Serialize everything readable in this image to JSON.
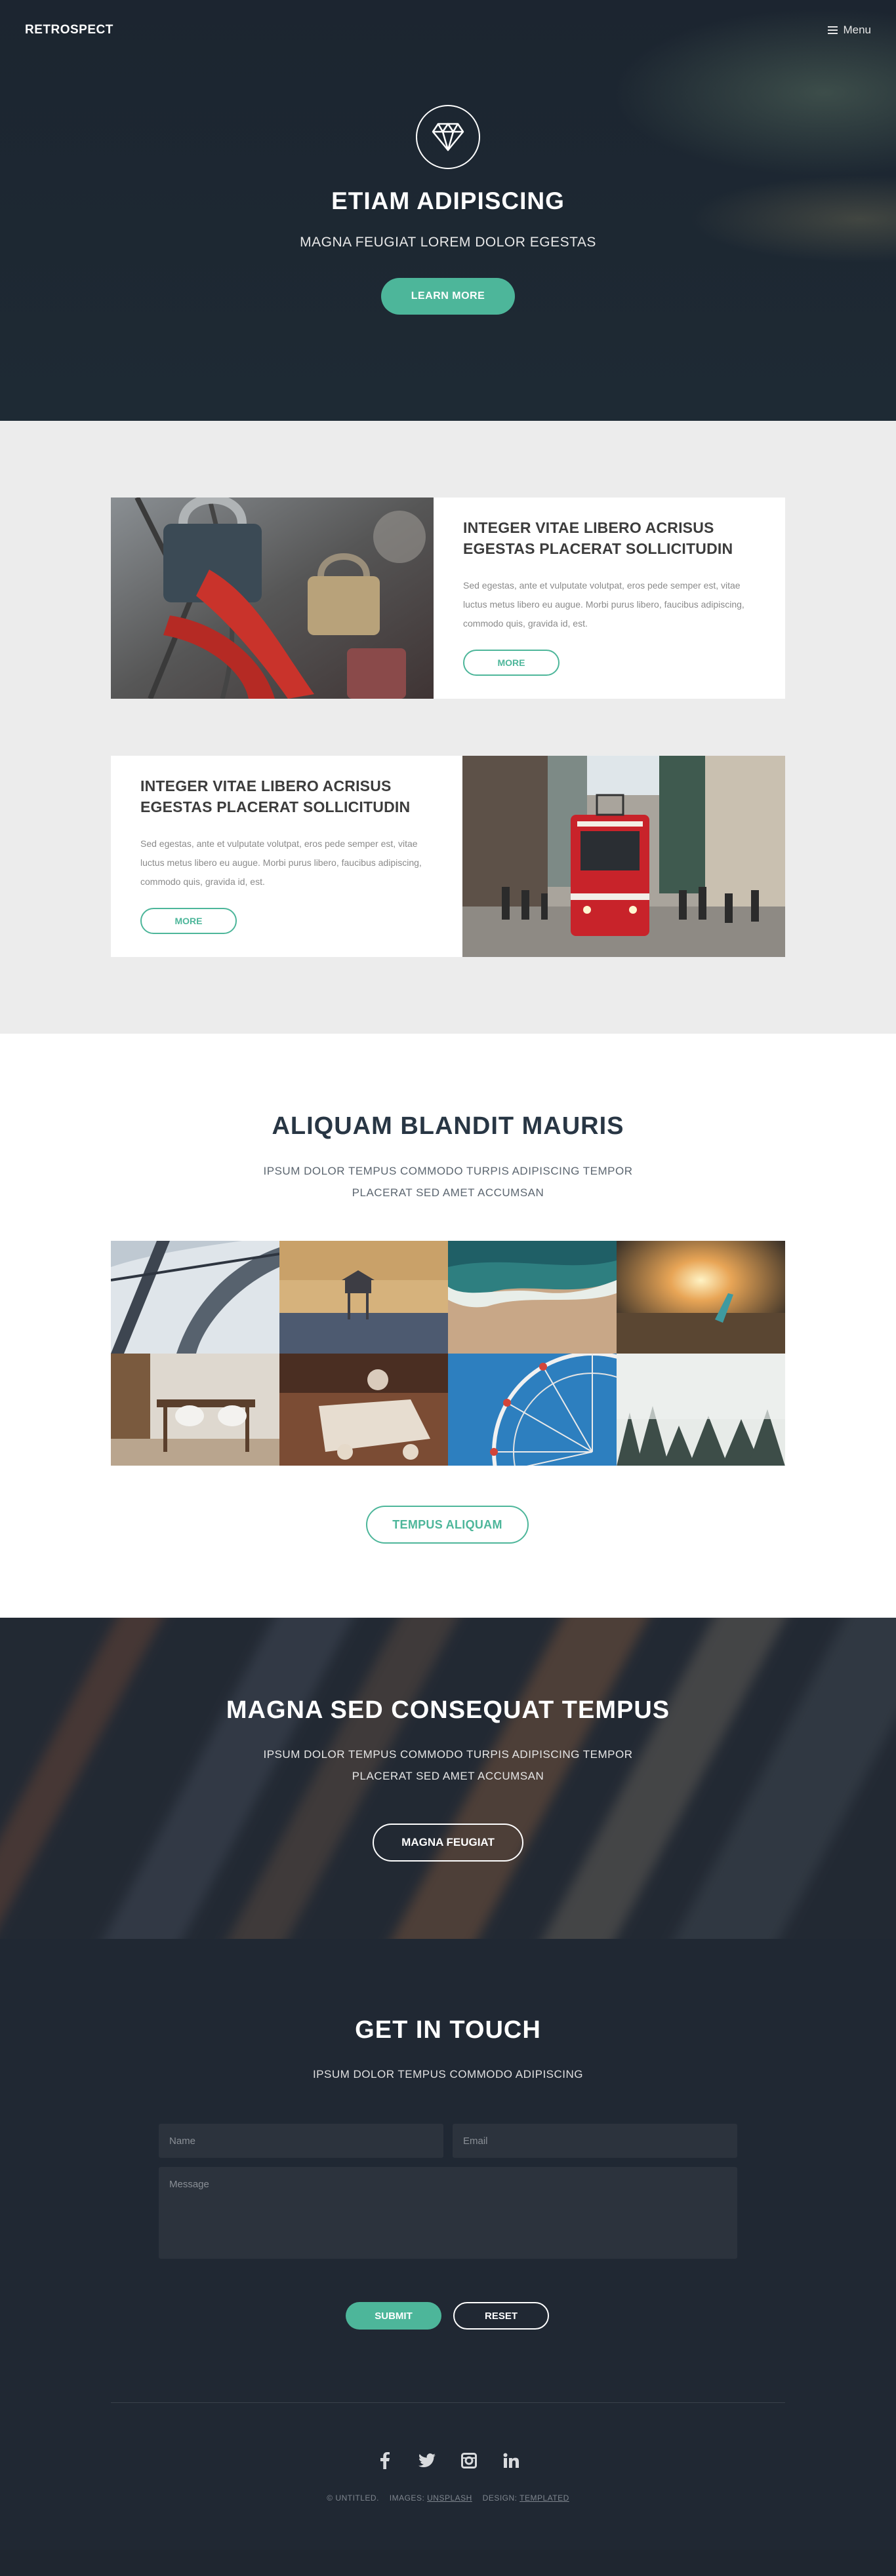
{
  "header": {
    "logo": "RETROSPECT",
    "menu_label": "Menu"
  },
  "hero": {
    "title": "ETIAM ADIPISCING",
    "subtitle": "MAGNA FEUGIAT LOREM DOLOR EGESTAS",
    "button": "LEARN MORE"
  },
  "features": [
    {
      "title": "INTEGER VITAE LIBERO ACRISUS EGESTAS PLACERAT SOLLICITUDIN",
      "text": "Sed egestas, ante et vulputate volutpat, eros pede semper est, vitae luctus metus libero eu augue. Morbi purus libero, faucibus adipiscing, commodo quis, gravida id, est.",
      "button": "MORE"
    },
    {
      "title": "INTEGER VITAE LIBERO ACRISUS EGESTAS PLACERAT SOLLICITUDIN",
      "text": "Sed egestas, ante et vulputate volutpat, eros pede semper est, vitae luctus metus libero eu augue. Morbi purus libero, faucibus adipiscing, commodo quis, gravida id, est.",
      "button": "MORE"
    }
  ],
  "gallery": {
    "title": "ALIQUAM BLANDIT MAURIS",
    "subtitle_line1": "IPSUM DOLOR TEMPUS COMMODO TURPIS ADIPISCING TEMPOR",
    "subtitle_line2": "PLACERAT SED AMET ACCUMSAN",
    "button": "TEMPUS ALIQUAM"
  },
  "banner": {
    "title": "MAGNA SED CONSEQUAT TEMPUS",
    "subtitle_line1": "IPSUM DOLOR TEMPUS COMMODO TURPIS ADIPISCING TEMPOR",
    "subtitle_line2": "PLACERAT SED AMET ACCUMSAN",
    "button": "MAGNA FEUGIAT"
  },
  "contact": {
    "title": "GET IN TOUCH",
    "subtitle": "IPSUM DOLOR TEMPUS COMMODO ADIPISCING",
    "name_placeholder": "Name",
    "email_placeholder": "Email",
    "message_placeholder": "Message",
    "submit": "SUBMIT",
    "reset": "RESET"
  },
  "footer": {
    "social_icons": [
      "facebook-icon",
      "twitter-icon",
      "instagram-icon",
      "linkedin-icon"
    ],
    "copyright": "© UNTITLED.",
    "images_label": "IMAGES:",
    "images_link": "UNSPLASH",
    "design_label": "DESIGN:",
    "design_link": "TEMPLATED"
  },
  "colors": {
    "accent": "#4db69a",
    "dark": "#202833",
    "light_bg": "#ececec"
  }
}
